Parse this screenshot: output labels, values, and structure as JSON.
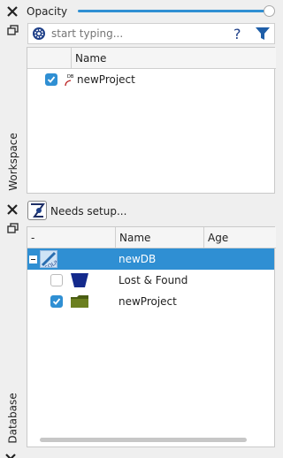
{
  "top": {
    "opacity_label": "Opacity",
    "opacity_value_percent": 100,
    "search_placeholder": "start typing...",
    "help_glyph": "?",
    "workspace_label": "Workspace",
    "columns": [
      "",
      "Name"
    ],
    "items": [
      {
        "checked": true,
        "name": "newProject",
        "icon": "project-icon"
      }
    ]
  },
  "bottom": {
    "status_text": "Needs setup...",
    "database_label": "Database",
    "columns": [
      "-",
      "Name",
      "Age"
    ],
    "rows": [
      {
        "expand": "-",
        "icon": "sqlite-db-icon",
        "name": "newDB",
        "selected": true,
        "has_checkbox": false
      },
      {
        "icon": "trash-bucket-icon",
        "name": "Lost & Found",
        "checked": false,
        "has_checkbox": true
      },
      {
        "icon": "folder-icon",
        "name": "newProject",
        "checked": true,
        "has_checkbox": true
      }
    ]
  },
  "colors": {
    "accent": "#2f8fd3",
    "selection": "#2f8fd3",
    "filter": "#1e5ea8"
  }
}
